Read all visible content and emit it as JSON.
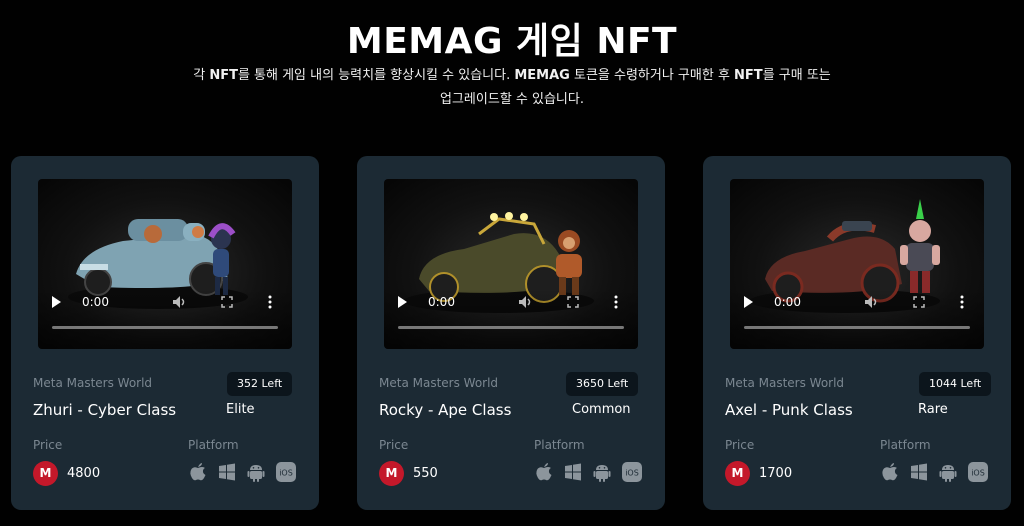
{
  "header": {
    "title": "MEMAG 게임 NFT",
    "subtitle_line1_a": "각 ",
    "subtitle_line1_b": "NFT",
    "subtitle_line1_c": "를 통해 게임 내의 능력치를 향상시킬 수 있습니다. ",
    "subtitle_line1_d": "MEMAG",
    "subtitle_line1_e": " 토큰을 수령하거나 구매한 후 ",
    "subtitle_line1_f": "NFT",
    "subtitle_line1_g": "를 구매 또는",
    "subtitle_line2": "업그레이드할 수 있습니다."
  },
  "labels": {
    "price": "Price",
    "platform": "Platform"
  },
  "cards": [
    {
      "world": "Meta Masters World",
      "left": "352 Left",
      "name": "Zhuri - Cyber Class",
      "tier": "Elite",
      "coin": "M",
      "price": "4800",
      "video_time": "0:00"
    },
    {
      "world": "Meta Masters World",
      "left": "3650 Left",
      "name": "Rocky - Ape Class",
      "tier": "Common",
      "coin": "M",
      "price": "550",
      "video_time": "0:00"
    },
    {
      "world": "Meta Masters World",
      "left": "1044 Left",
      "name": "Axel - Punk Class",
      "tier": "Rare",
      "coin": "M",
      "price": "1700",
      "video_time": "0:00"
    }
  ],
  "platform_icons": [
    "apple-icon",
    "windows-icon",
    "android-icon",
    "ios-icon"
  ],
  "ios_text": "iOS",
  "colors": {
    "background": "#010101",
    "card": "#1c2a34",
    "badge": "#0c151c",
    "muted_text": "#7b8791",
    "coin": "#c4182a",
    "platform_icon": "#8c959c"
  }
}
